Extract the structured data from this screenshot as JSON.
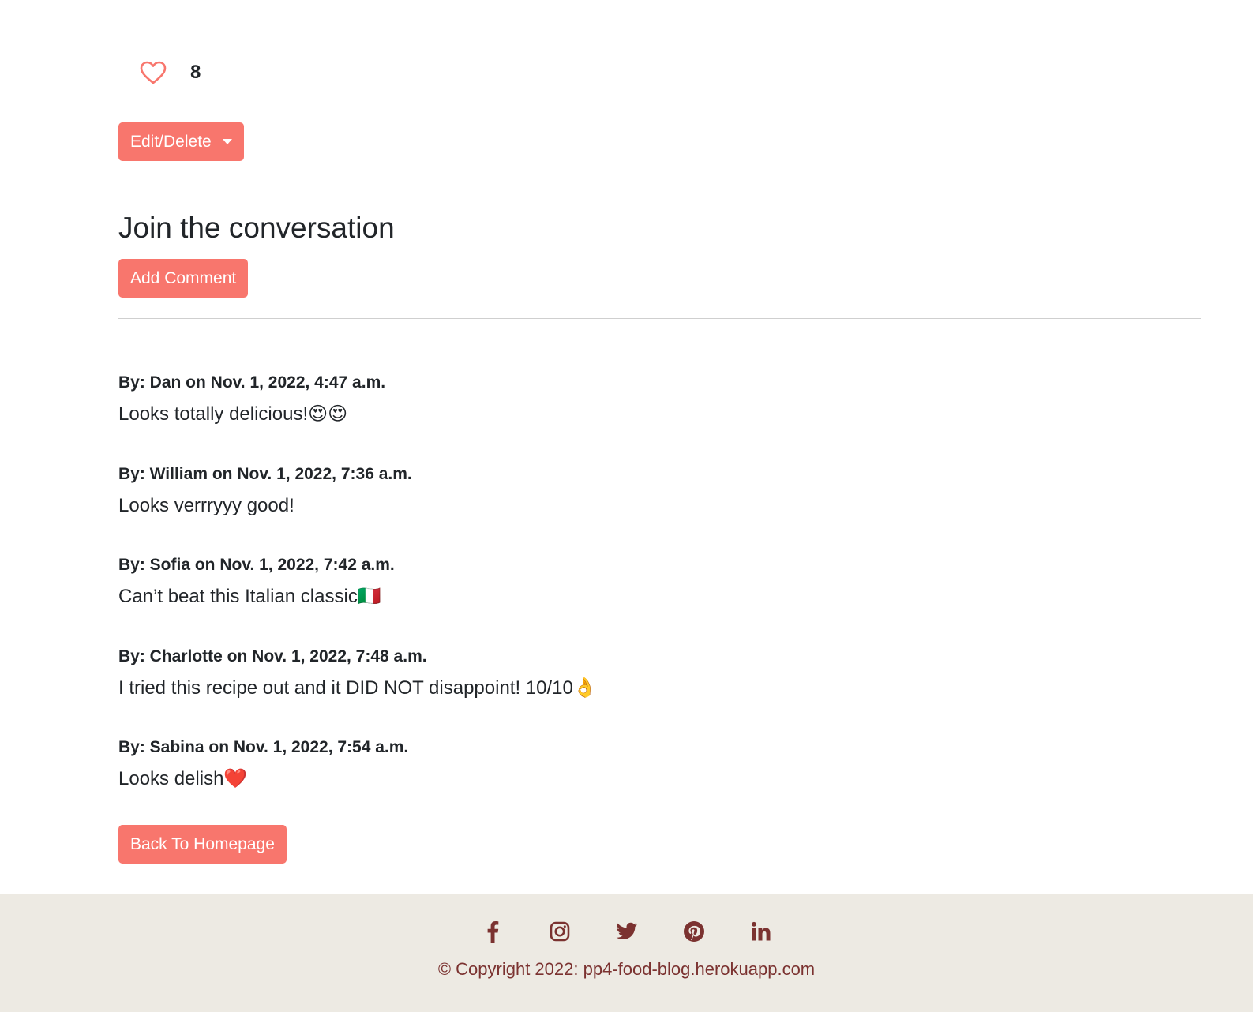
{
  "likes": {
    "count": "8",
    "icon": "heart-outline-icon",
    "color": "#f8766d"
  },
  "actions": {
    "edit_delete_label": "Edit/Delete",
    "add_comment_label": "Add Comment",
    "back_label": "Back To Homepage"
  },
  "conversation": {
    "title": "Join the conversation"
  },
  "comments": [
    {
      "meta": "By: Dan on Nov. 1, 2022, 4:47 a.m.",
      "body": "Looks totally delicious!😍😍"
    },
    {
      "meta": "By: William on Nov. 1, 2022, 7:36 a.m.",
      "body": "Looks verrryyy good!"
    },
    {
      "meta": "By: Sofia on Nov. 1, 2022, 7:42 a.m.",
      "body": "Can’t beat this Italian classic🇮🇹"
    },
    {
      "meta": "By: Charlotte on Nov. 1, 2022, 7:48 a.m.",
      "body": "I tried this recipe out and it DID NOT disappoint! 10/10👌"
    },
    {
      "meta": "By: Sabina on Nov. 1, 2022, 7:54 a.m.",
      "body": "Looks delish❤️"
    }
  ],
  "footer": {
    "socials": [
      "facebook-icon",
      "instagram-icon",
      "twitter-icon",
      "pinterest-icon",
      "linkedin-icon"
    ],
    "copyright": "© Copyright 2022: pp4-food-blog.herokuapp.com",
    "background": "#edeae3",
    "text_color": "#7b3230"
  },
  "colors": {
    "accent": "#f8766d",
    "text": "#212529"
  }
}
